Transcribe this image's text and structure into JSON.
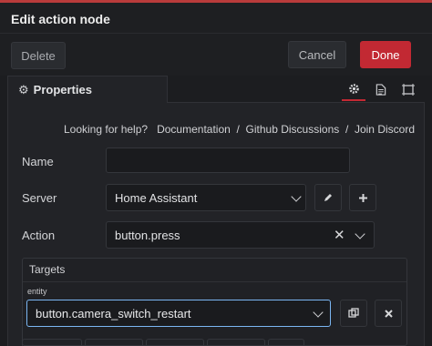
{
  "window": {
    "title": "Edit action node"
  },
  "toolbar": {
    "delete_label": "Delete",
    "cancel_label": "Cancel",
    "done_label": "Done"
  },
  "tabs": {
    "properties_label": "Properties",
    "icons": [
      "gear-icon",
      "document-icon",
      "frame-icon"
    ]
  },
  "help": {
    "prefix": "Looking for help?",
    "links": [
      "Documentation",
      "Github Discussions",
      "Join Discord"
    ],
    "separator": "/"
  },
  "form": {
    "name": {
      "label": "Name",
      "value": ""
    },
    "server": {
      "label": "Server",
      "value": "Home Assistant"
    },
    "action": {
      "label": "Action",
      "value": "button.press"
    },
    "targets": {
      "label": "Targets",
      "entity_label": "entity",
      "entity_value": "button.camera_switch_restart"
    }
  },
  "colors": {
    "accent": "#c22933",
    "focus": "#7bb6f2",
    "background": "#1c1d20"
  }
}
